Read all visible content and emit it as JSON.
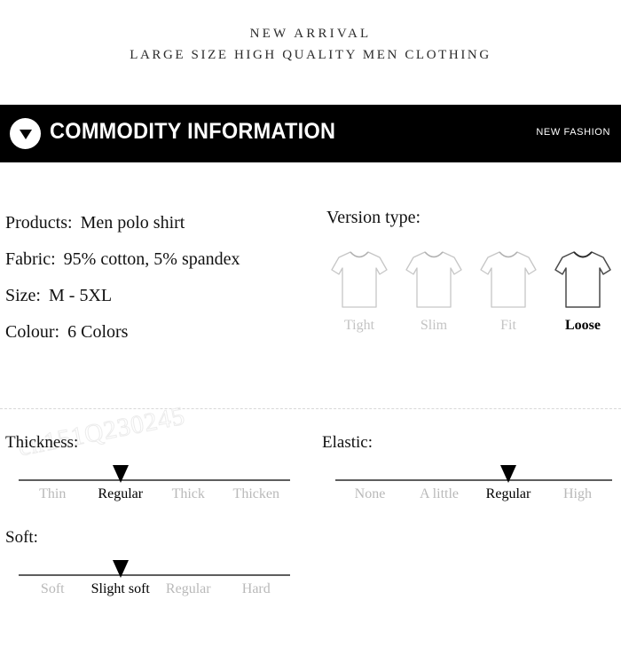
{
  "header": {
    "line1": "NEW ARRIVAL",
    "line2": "LARGE SIZE HIGH QUALITY MEN CLOTHING"
  },
  "banner": {
    "icon": "triangle-down-icon",
    "title": "COMMODITY INFORMATION",
    "tag": "NEW FASHION",
    "background": "#000000",
    "text_color": "#ffffff"
  },
  "specs": [
    {
      "key": "Products:",
      "value": "Men polo shirt"
    },
    {
      "key": "Fabric:",
      "value": "95% cotton, 5% spandex"
    },
    {
      "key": "Size:",
      "value": "M - 5XL"
    },
    {
      "key": "Colour:",
      "value": "6 Colors"
    }
  ],
  "version": {
    "title": "Version type:",
    "options": [
      {
        "label": "Tight",
        "selected": false
      },
      {
        "label": "Slim",
        "selected": false
      },
      {
        "label": "Fit",
        "selected": false
      },
      {
        "label": "Loose",
        "selected": true
      }
    ],
    "selected": "Loose",
    "inactive_color": "#c3c3c3",
    "active_color": "#000000"
  },
  "scales": [
    {
      "id": "thickness",
      "title": "Thickness:",
      "options": [
        "Thin",
        "Regular",
        "Thick",
        "Thicken"
      ],
      "selected": "Regular",
      "selected_index": 1
    },
    {
      "id": "elastic",
      "title": "Elastic:",
      "options": [
        "None",
        "A little",
        "Regular",
        "High"
      ],
      "selected": "Regular",
      "selected_index": 2
    },
    {
      "id": "soft",
      "title": "Soft:",
      "options": [
        "Soft",
        "Slight soft",
        "Regular",
        "Hard"
      ],
      "selected": "Slight soft",
      "selected_index": 1
    }
  ],
  "watermark": "cn151Q230245"
}
